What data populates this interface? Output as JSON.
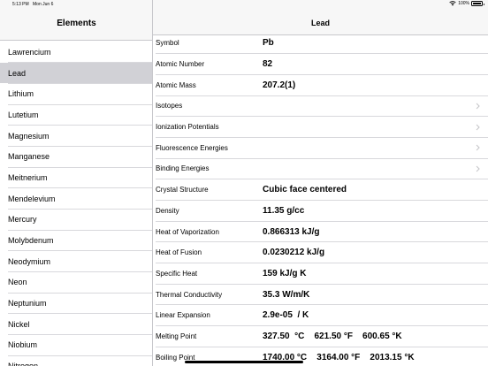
{
  "status_bar": {
    "time": "5:13 PM",
    "date": "Mon Jun 6",
    "battery": "100%"
  },
  "sidebar": {
    "title": "Elements",
    "items": [
      {
        "label": "Lawrencium"
      },
      {
        "label": "Lead",
        "selected": true
      },
      {
        "label": "Lithium"
      },
      {
        "label": "Lutetium"
      },
      {
        "label": "Magnesium"
      },
      {
        "label": "Manganese"
      },
      {
        "label": "Meitnerium"
      },
      {
        "label": "Mendelevium"
      },
      {
        "label": "Mercury"
      },
      {
        "label": "Molybdenum"
      },
      {
        "label": "Neodymium"
      },
      {
        "label": "Neon"
      },
      {
        "label": "Neptunium"
      },
      {
        "label": "Nickel"
      },
      {
        "label": "Niobium"
      },
      {
        "label": "Nitrogen"
      }
    ]
  },
  "detail": {
    "title": "Lead",
    "rows": [
      {
        "label": "Symbol",
        "value": "Pb"
      },
      {
        "label": "Atomic Number",
        "value": "82"
      },
      {
        "label": "Atomic Mass",
        "value": "207.2(1)"
      },
      {
        "label": "Isotopes",
        "value": "",
        "chevron": true
      },
      {
        "label": "Ionization Potentials",
        "value": "",
        "chevron": true
      },
      {
        "label": "Fluorescence Energies",
        "value": "",
        "chevron": true
      },
      {
        "label": "Binding Energies",
        "value": "",
        "chevron": true
      },
      {
        "label": "Crystal Structure",
        "value": "Cubic face centered"
      },
      {
        "label": "Density",
        "value": "11.35 g/cc"
      },
      {
        "label": "Heat of Vaporization",
        "value": "0.866313 kJ/g"
      },
      {
        "label": "Heat of Fusion",
        "value": "0.0230212 kJ/g"
      },
      {
        "label": "Specific Heat",
        "value": "159 kJ/g K"
      },
      {
        "label": "Thermal Conductivity",
        "value": "35.3 W/m/K"
      },
      {
        "label": "Linear Expansion",
        "value": "2.9e-05  / K"
      },
      {
        "label": "Melting Point",
        "value": "327.50  °C    621.50 °F    600.65 °K"
      },
      {
        "label": "Boiling Point",
        "value": "1740.00 °C    3164.00 °F    2013.15 °K"
      }
    ]
  },
  "icons": {
    "wifi": "wifi-icon",
    "battery": "battery-icon",
    "chevron": "chevron-right-icon"
  },
  "colors": {
    "selected_row": "#d1d1d6",
    "header_bg": "#f7f7f7",
    "chevron": "#c4c4c7"
  }
}
